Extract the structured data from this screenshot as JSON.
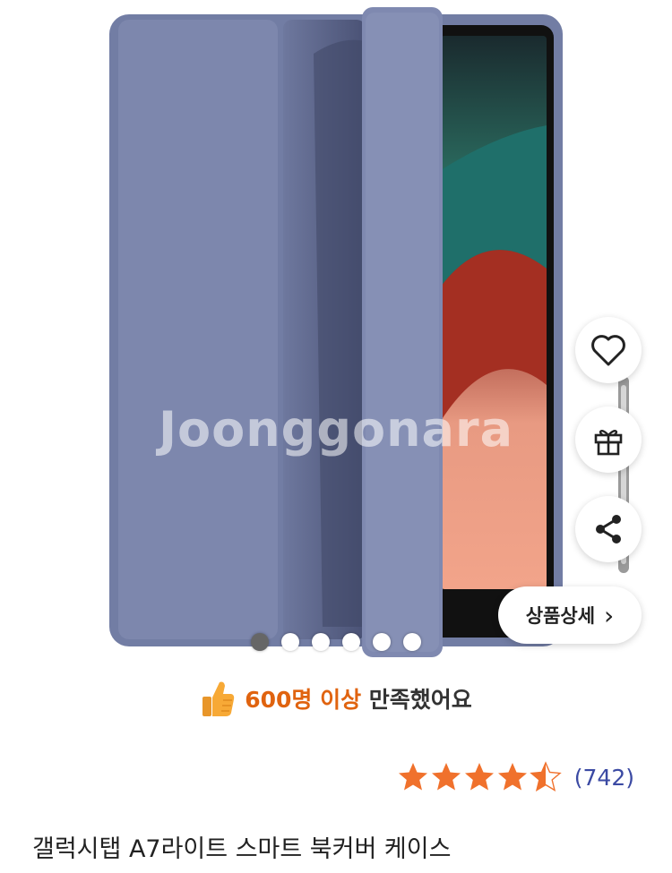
{
  "product": {
    "image_watermark": "Joonggonara",
    "title": "갤럭시탭 A7라이트 스마트 북커버 케이스",
    "image_count": 6,
    "active_image_index": 1
  },
  "actions": {
    "wishlist_icon": "heart-icon",
    "gift_icon": "gift-icon",
    "share_icon": "share-icon",
    "detail_label": "상품상세",
    "detail_chevron": "›"
  },
  "satisfaction": {
    "highlight": "600명 이상",
    "text": "만족했어요",
    "icon": "thumbs-up-icon"
  },
  "rating": {
    "stars": 4.5,
    "max_stars": 5,
    "count": "(742)",
    "star_color": "#f0712c"
  },
  "colors": {
    "case_color": "#7e88ae",
    "accent_orange": "#e0630f",
    "link_blue": "#3b4aa3"
  }
}
